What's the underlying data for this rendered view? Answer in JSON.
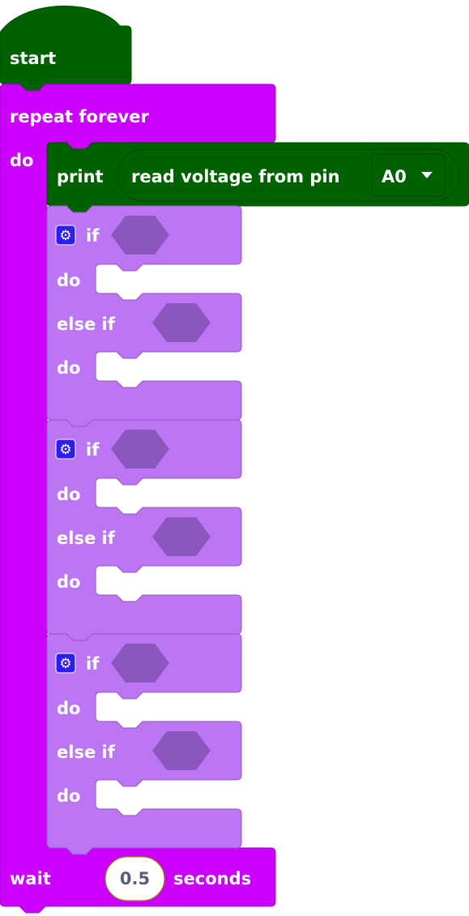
{
  "colors": {
    "event_green": "#006100",
    "loop_magenta": "#cc00ff",
    "if_purple": "#bb75f5",
    "if_border": "#9658c4",
    "hex_slot": "#8c57bd",
    "mutator_blue": "#2b1ef0"
  },
  "start_block": {
    "label": "start"
  },
  "repeat_block": {
    "label": "repeat forever",
    "do_label": "do"
  },
  "print_block": {
    "label": "print",
    "reporter": {
      "label": "read voltage from pin",
      "pin_value": "A0",
      "dropdown_icon": "triangle-down"
    }
  },
  "if_blocks": [
    {
      "mutator_icon": "gear",
      "if_label": "if",
      "do_label": "do",
      "else_if_label": "else if",
      "do2_label": "do"
    },
    {
      "mutator_icon": "gear",
      "if_label": "if",
      "do_label": "do",
      "else_if_label": "else if",
      "do2_label": "do"
    },
    {
      "mutator_icon": "gear",
      "if_label": "if",
      "do_label": "do",
      "else_if_label": "else if",
      "do2_label": "do"
    }
  ],
  "wait_block": {
    "label": "wait",
    "value": "0.5",
    "unit_label": "seconds"
  }
}
